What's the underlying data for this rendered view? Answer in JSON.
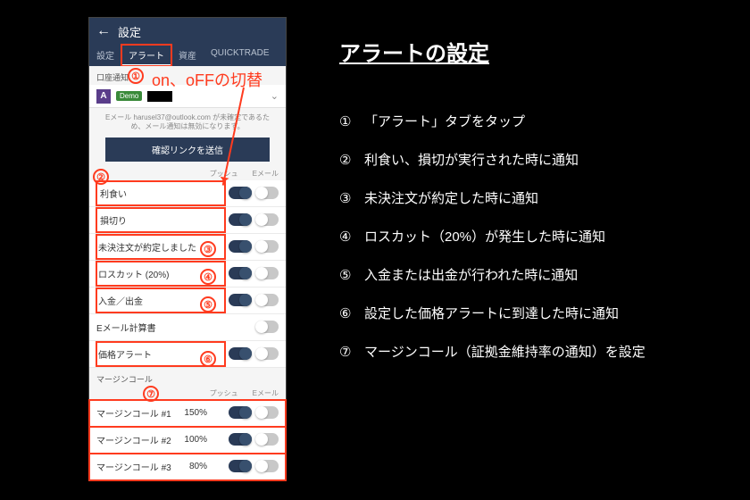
{
  "app": {
    "header_title": "設定",
    "tabs": [
      {
        "label": "設定",
        "active": false
      },
      {
        "label": "アラート",
        "active": true
      },
      {
        "label": "資産",
        "active": false
      },
      {
        "label": "QUICKTRADE",
        "active": false
      }
    ],
    "account_section_label": "口座通知",
    "account": {
      "demo_badge": "Demo"
    },
    "email_notice": "Eメール harusel37@outlook.com が未確定であるため、メール通知は無効になります。",
    "confirm_button": "確認リンクを送信",
    "col_headers": {
      "push": "プッシュ",
      "email": "Eメール"
    },
    "rows": [
      {
        "id": "takeprofit",
        "label": "利食い",
        "push": true,
        "email": false,
        "red": true
      },
      {
        "id": "stoploss",
        "label": "損切り",
        "push": true,
        "email": false,
        "red": true
      },
      {
        "id": "pending",
        "label": "未決注文が約定しました",
        "push": true,
        "email": false,
        "red": true
      },
      {
        "id": "losscut",
        "label": "ロスカット (20%)",
        "push": true,
        "email": false,
        "red": true
      },
      {
        "id": "deposit",
        "label": "入金／出金",
        "push": true,
        "email": false,
        "red": true
      },
      {
        "id": "emailreport",
        "label": "Eメール計算書",
        "push": null,
        "email": false,
        "red": false
      },
      {
        "id": "pricealert",
        "label": "価格アラート",
        "push": true,
        "email": false,
        "red": true
      }
    ],
    "margin_section_label": "マージンコール",
    "margin_rows": [
      {
        "id": "mc1",
        "label": "マージンコール #1",
        "pct": "150%",
        "push": true,
        "email": false
      },
      {
        "id": "mc2",
        "label": "マージンコール #2",
        "pct": "100%",
        "push": true,
        "email": false
      },
      {
        "id": "mc3",
        "label": "マージンコール #3",
        "pct": "80%",
        "push": true,
        "email": false
      }
    ]
  },
  "overlay": {
    "toggle_note": "on、oFFの切替",
    "circles": [
      "①",
      "②",
      "③",
      "④",
      "⑤",
      "⑥",
      "⑦"
    ]
  },
  "explain": {
    "title": "アラートの設定",
    "steps": [
      {
        "n": "①",
        "text": "「アラート」タブをタップ"
      },
      {
        "n": "②",
        "text": "利食い、損切が実行された時に通知"
      },
      {
        "n": "③",
        "text": "未決注文が約定した時に通知"
      },
      {
        "n": "④",
        "text": "ロスカット（20%）が発生した時に通知"
      },
      {
        "n": "⑤",
        "text": "入金または出金が行われた時に通知"
      },
      {
        "n": "⑥",
        "text": "設定した価格アラートに到達した時に通知"
      },
      {
        "n": "⑦",
        "text": "マージンコール（証拠金維持率の通知）を設定"
      }
    ]
  }
}
